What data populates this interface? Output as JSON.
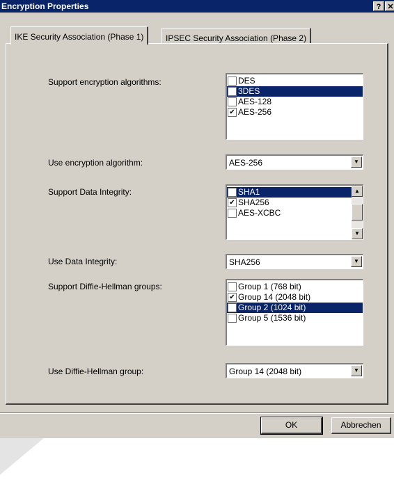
{
  "window": {
    "title": "Encryption Properties",
    "help_glyph": "?",
    "close_glyph": "✕"
  },
  "tabs": [
    {
      "label": "IKE Security Association (Phase 1)",
      "active": true
    },
    {
      "label": "IPSEC Security Association (Phase 2)",
      "active": false
    }
  ],
  "encryption": {
    "support_label": "Support encryption algorithms:",
    "items": [
      {
        "label": "DES",
        "checked": false,
        "selected": false
      },
      {
        "label": "3DES",
        "checked": false,
        "selected": true
      },
      {
        "label": "AES-128",
        "checked": false,
        "selected": false
      },
      {
        "label": "AES-256",
        "checked": true,
        "selected": false
      }
    ],
    "use_label": "Use encryption algorithm:",
    "use_value": "AES-256"
  },
  "integrity": {
    "support_label": "Support Data Integrity:",
    "items": [
      {
        "label": "SHA1",
        "checked": false,
        "selected": true
      },
      {
        "label": "SHA256",
        "checked": true,
        "selected": false
      },
      {
        "label": "AES-XCBC",
        "checked": false,
        "selected": false
      }
    ],
    "use_label": "Use Data Integrity:",
    "use_value": "SHA256"
  },
  "dh": {
    "support_label": "Support Diffie-Hellman groups:",
    "items": [
      {
        "label": "Group 1 (768 bit)",
        "checked": false,
        "selected": false
      },
      {
        "label": "Group 14 (2048 bit)",
        "checked": true,
        "selected": false
      },
      {
        "label": "Group 2 (1024 bit)",
        "checked": false,
        "selected": true
      },
      {
        "label": "Group 5 (1536 bit)",
        "checked": false,
        "selected": false
      }
    ],
    "use_label": "Use Diffie-Hellman group:",
    "use_value": "Group 14 (2048 bit)"
  },
  "buttons": {
    "ok": "OK",
    "cancel": "Abbrechen"
  },
  "glyphs": {
    "check": "✔",
    "dropdown": "▼",
    "scroll_up": "▲",
    "scroll_down": "▼"
  },
  "colors": {
    "face": "#d4d0c8",
    "titlebar": "#0a246a",
    "selection": "#0a246a"
  }
}
